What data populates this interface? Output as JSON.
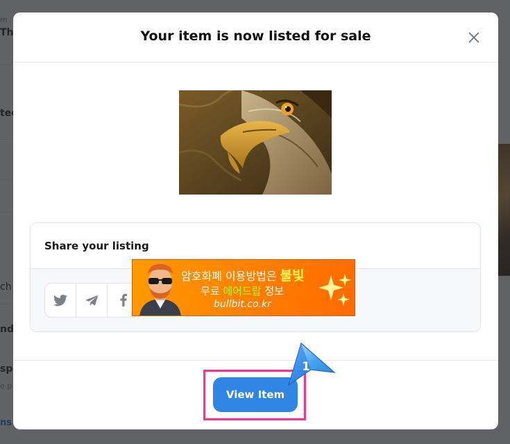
{
  "background": {
    "texts": [
      "m",
      "Th",
      "tec",
      "ch",
      "nd",
      "sp",
      "e p",
      "ns"
    ]
  },
  "modal": {
    "title": "Your item is now listed for sale",
    "close_icon": "close-icon"
  },
  "share": {
    "title": "Share your listing",
    "buttons": [
      {
        "icon": "twitter-icon"
      },
      {
        "icon": "telegram-icon"
      },
      {
        "icon": "facebook-icon"
      }
    ]
  },
  "ad": {
    "line1_prefix": "암호화폐 이용방법은 ",
    "line1_highlight": "불빛",
    "line2_prefix": "무료 ",
    "line2_highlight": "에어드랍",
    "line2_suffix": " 정보",
    "url": "bullbit.co.kr"
  },
  "footer": {
    "view_item_label": "View Item"
  },
  "step_marker": {
    "number": "1"
  },
  "colors": {
    "primary_button": "#2f86e5",
    "highlight_border": "#ea3c8c",
    "ad_orange": "#ff7f00"
  }
}
